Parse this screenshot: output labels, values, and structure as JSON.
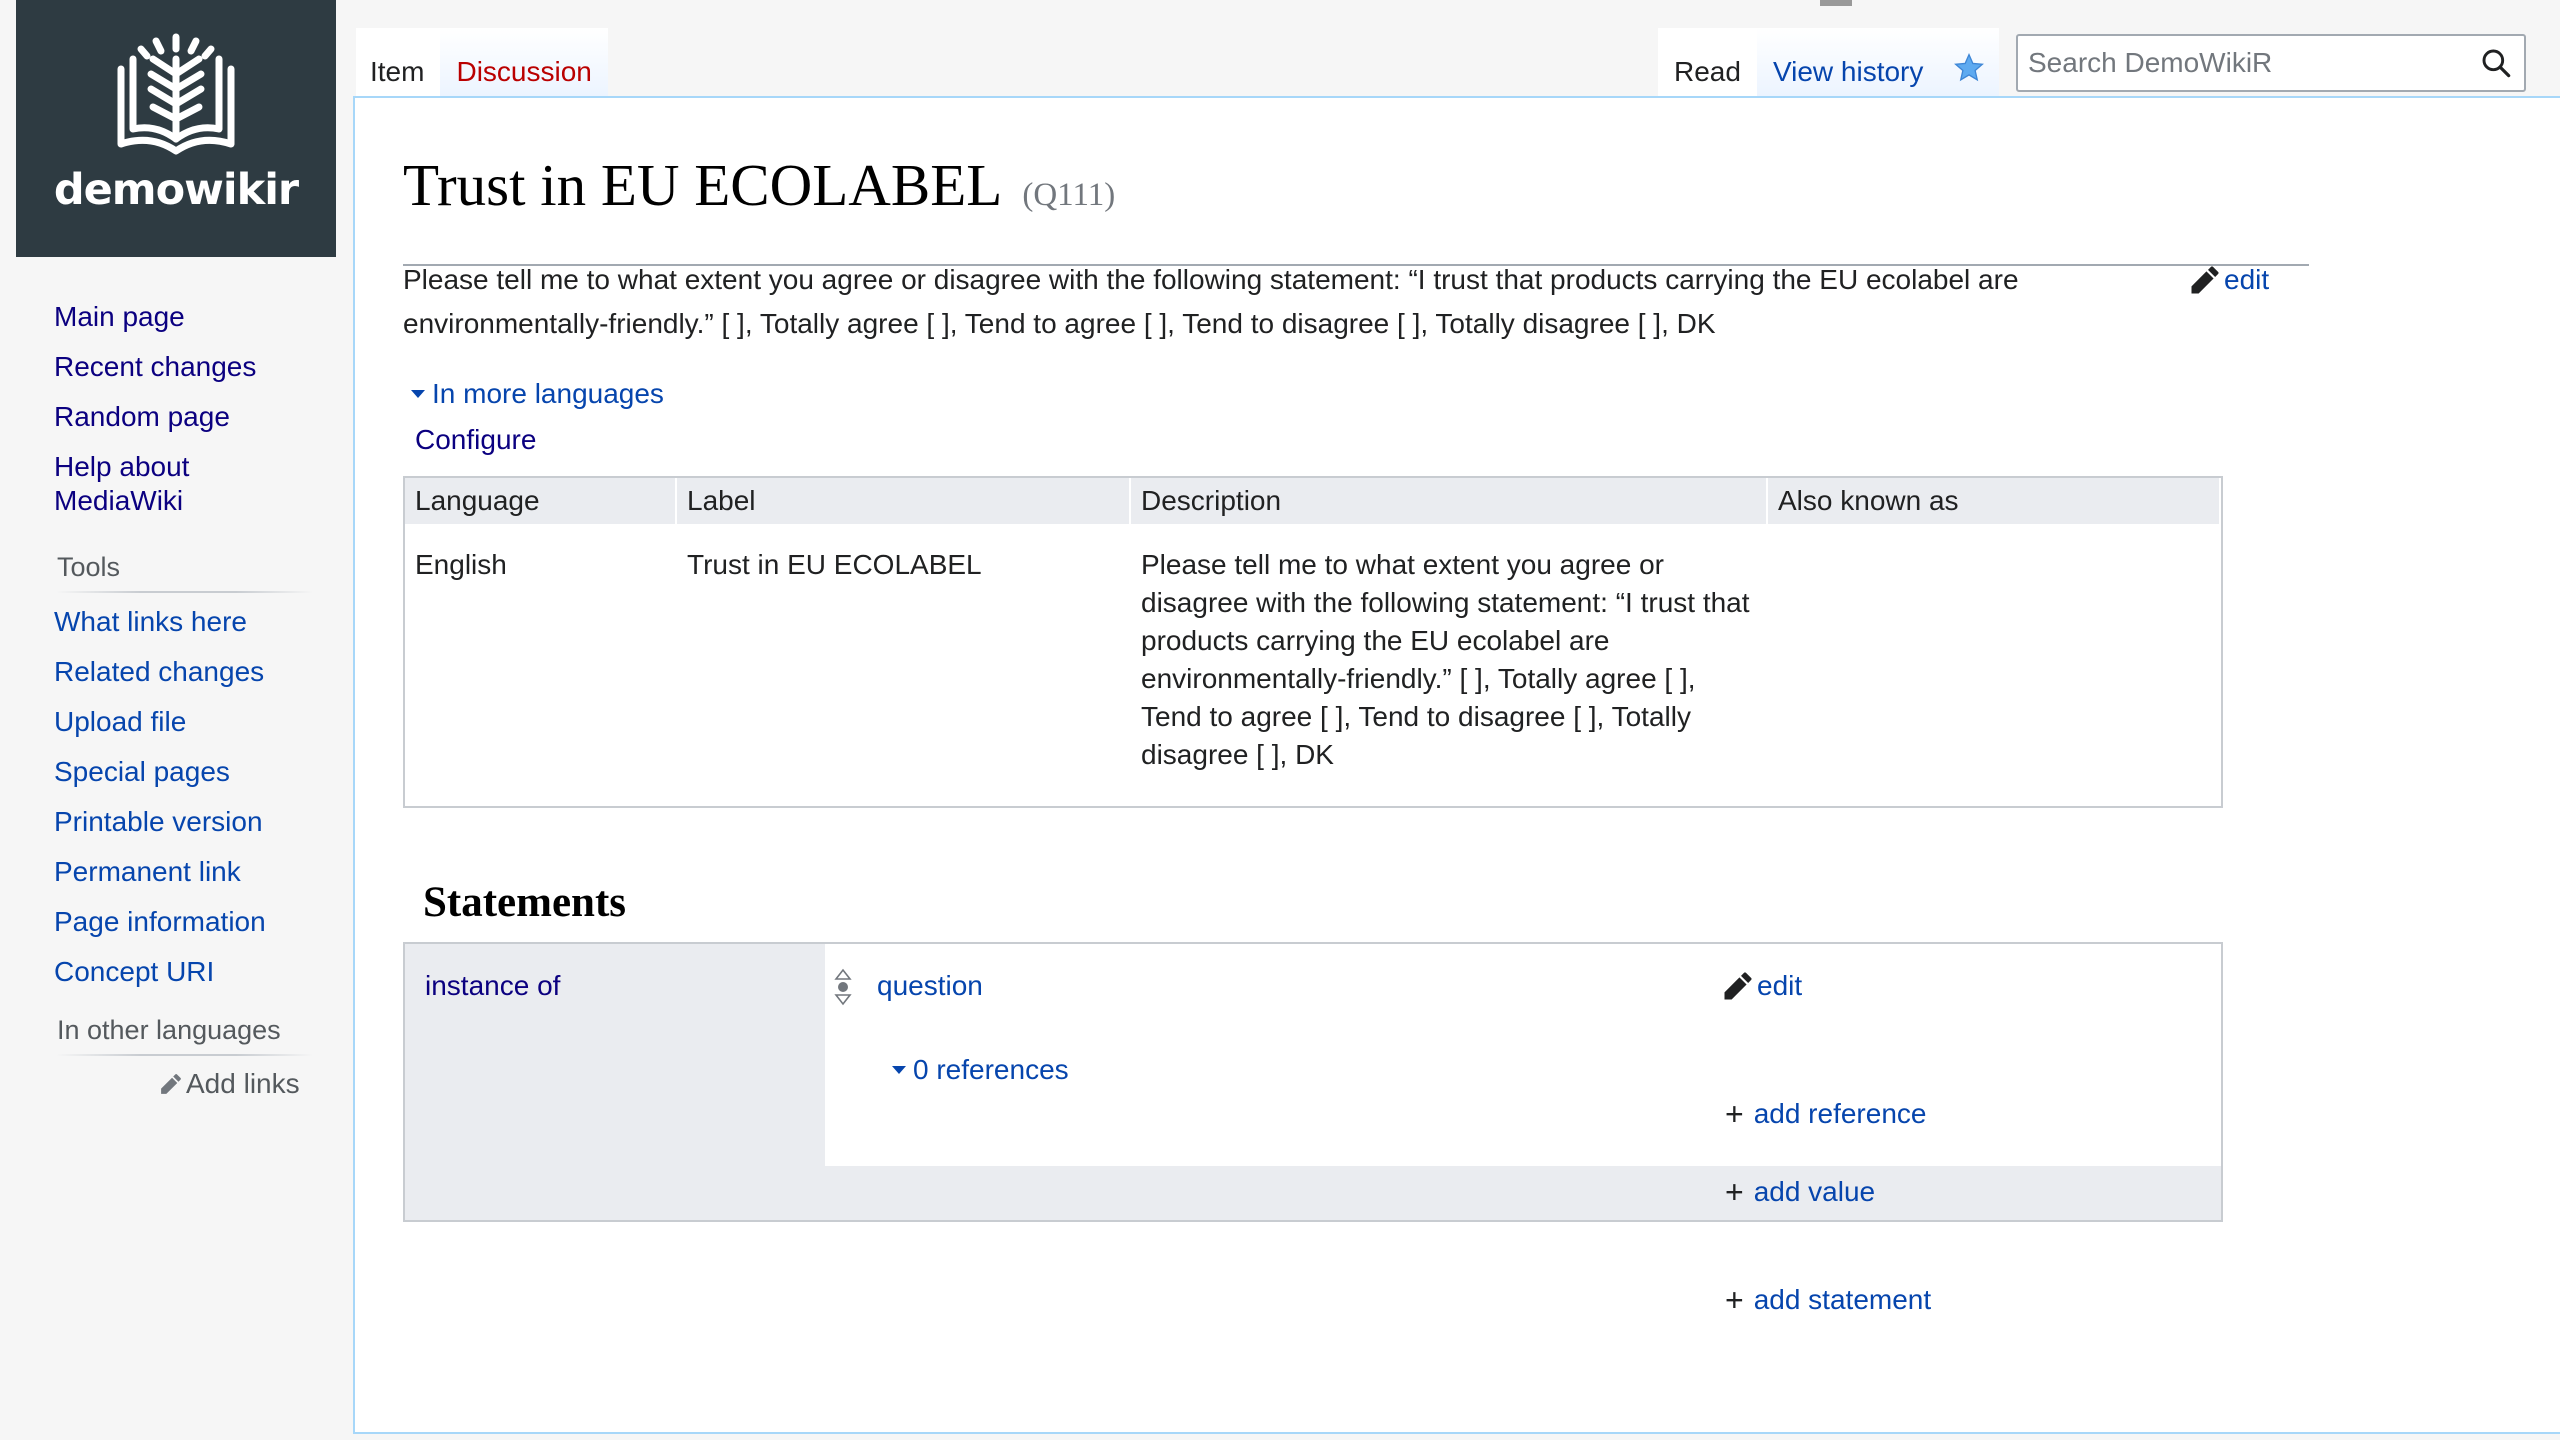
{
  "site": {
    "logo_text": "demowikir"
  },
  "sidebar": {
    "main_items": [
      {
        "label": "Main page"
      },
      {
        "label": "Recent changes"
      },
      {
        "label": "Random page"
      },
      {
        "label": "Help about MediaWiki"
      }
    ],
    "tools_heading": "Tools",
    "tools_items": [
      {
        "label": "What links here"
      },
      {
        "label": "Related changes"
      },
      {
        "label": "Upload file"
      },
      {
        "label": "Special pages"
      },
      {
        "label": "Printable version"
      },
      {
        "label": "Permanent link"
      },
      {
        "label": "Page information"
      },
      {
        "label": "Concept URI"
      }
    ],
    "languages_heading": "In other languages",
    "add_links_label": "Add links"
  },
  "tabs": {
    "item": "Item",
    "discussion": "Discussion",
    "read": "Read",
    "view_history": "View history"
  },
  "search": {
    "placeholder": "Search DemoWikiR"
  },
  "page": {
    "title": "Trust in EU ECOLABEL",
    "qid": "(Q111)",
    "description": "Please tell me to what extent you agree or disagree with the following statement: “I trust that products carrying the EU ecolabel are environmentally-friendly.” [ ], Totally agree [ ], Tend to agree [ ], Tend to disagree [ ], Totally disagree [ ], DK",
    "edit_label": "edit",
    "more_languages_label": "In more languages",
    "configure_label": "Configure"
  },
  "language_table": {
    "headers": [
      "Language",
      "Label",
      "Description",
      "Also known as"
    ],
    "rows": [
      {
        "language": "English",
        "label": "Trust in EU ECOLABEL",
        "description": "Please tell me to what extent you agree or disagree with the following statement: “I trust that products carrying the EU ecolabel are environmentally-friendly.” [ ], Totally agree [ ], Tend to agree [ ], Tend to disagree [ ], Totally disagree [ ], DK",
        "aliases": ""
      }
    ]
  },
  "statements": {
    "heading": "Statements",
    "groups": [
      {
        "property": "instance of",
        "value": "question",
        "edit_label": "edit",
        "references_label": "0 references",
        "add_reference_label": "add reference",
        "add_value_label": "add value"
      }
    ],
    "add_statement_label": "add statement"
  },
  "colors": {
    "link": "#0645ad",
    "visited_link": "#0b0080",
    "red_link": "#ba0000",
    "logo_bg": "#2e3b42",
    "border": "#a7d7f9"
  }
}
